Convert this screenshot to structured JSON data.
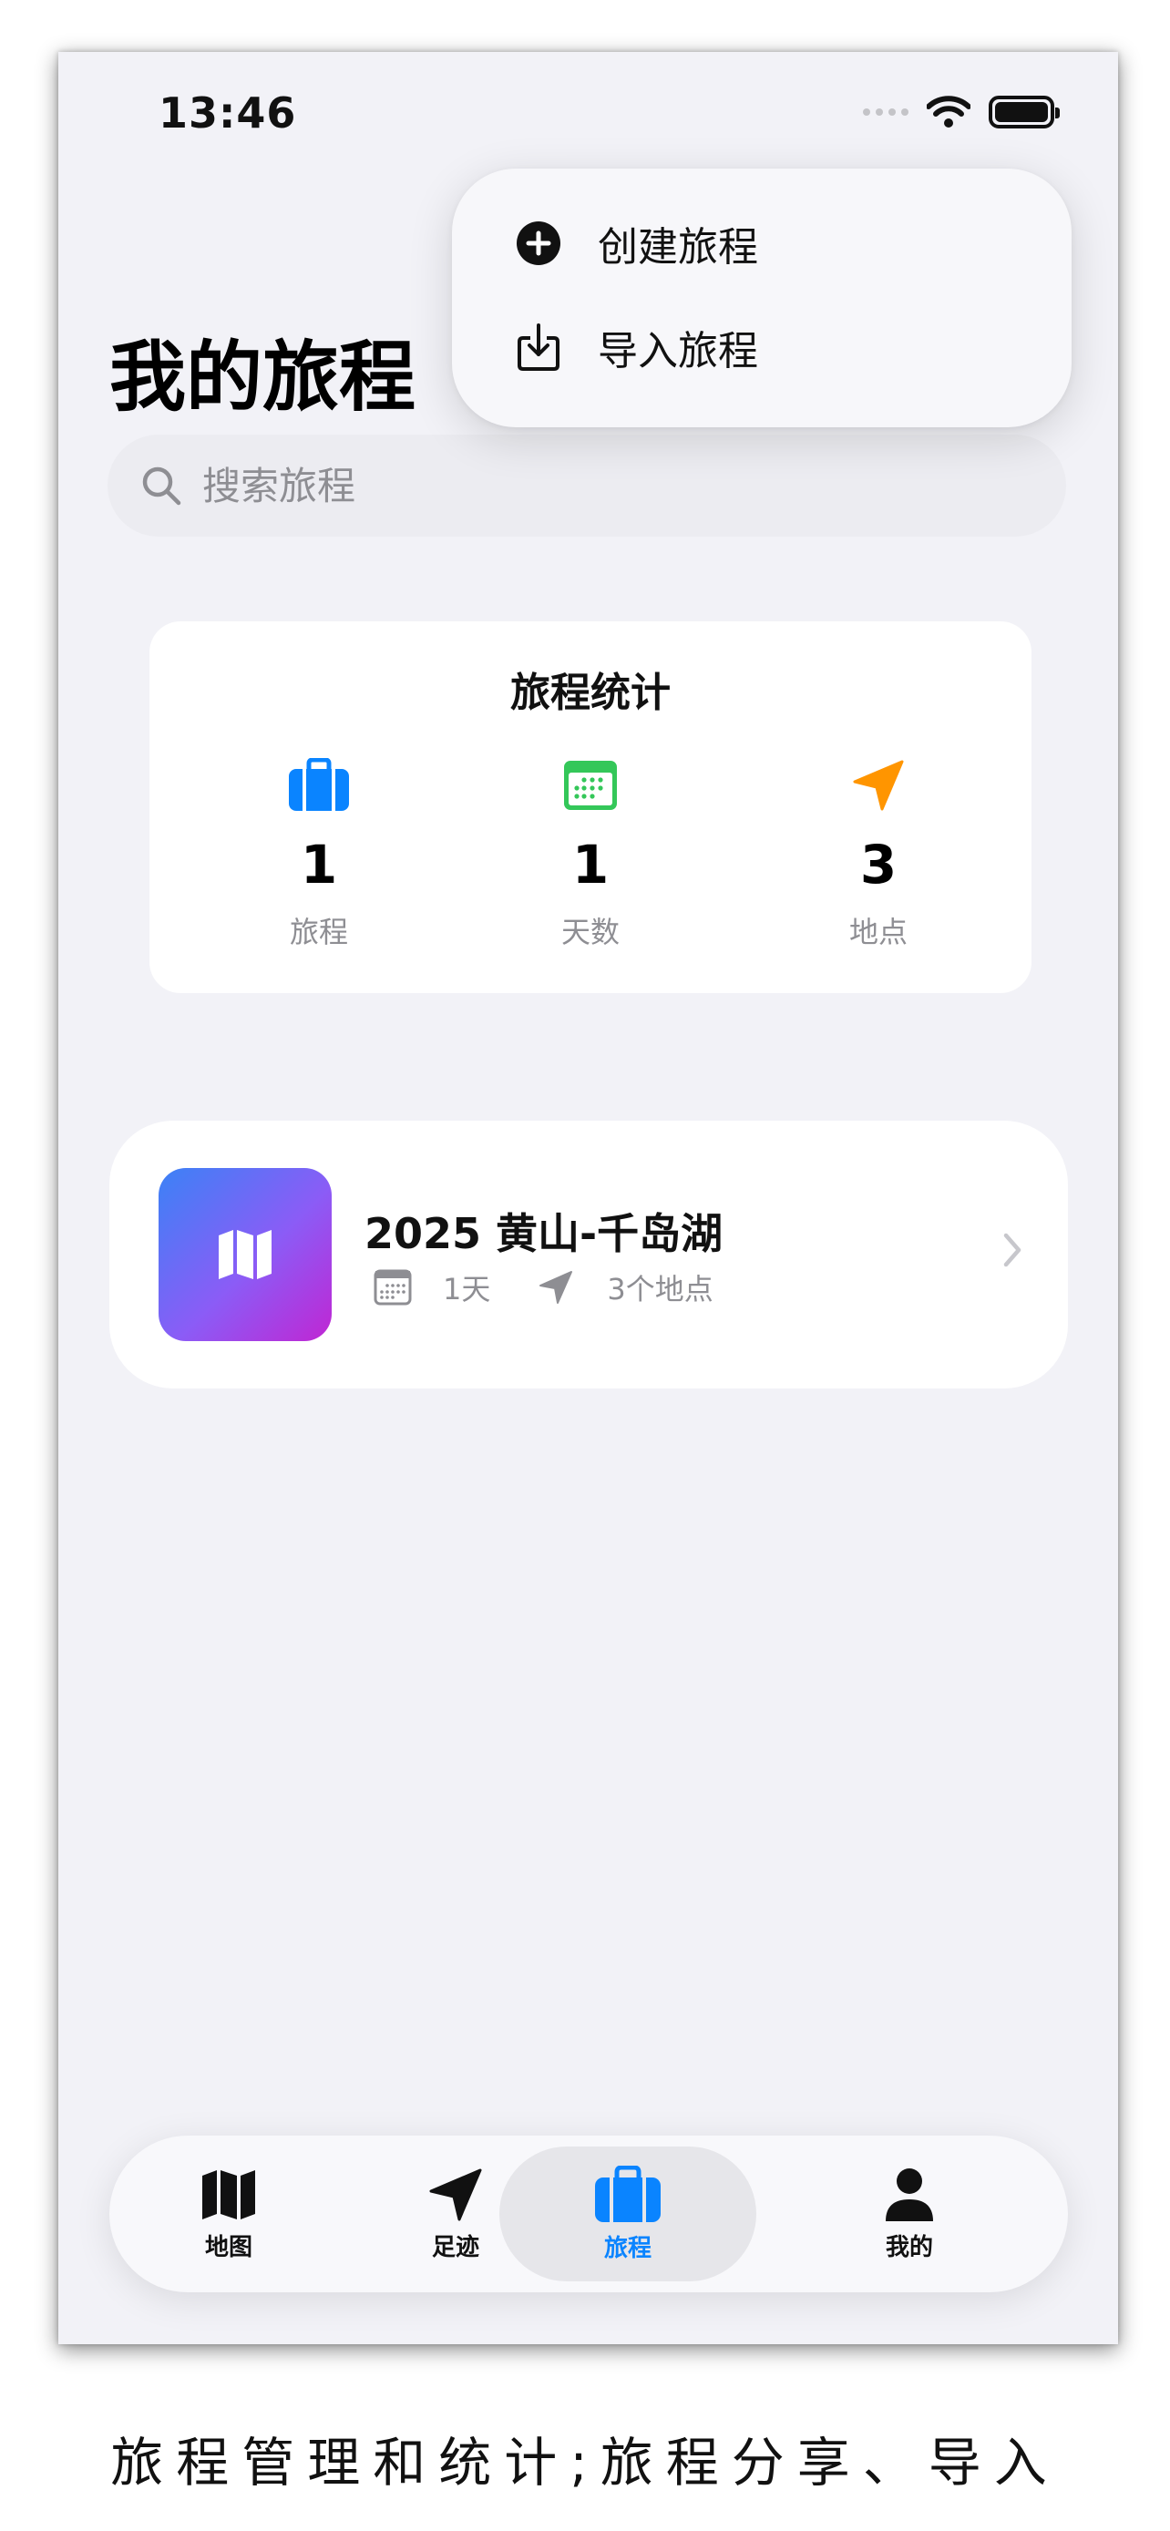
{
  "status_bar": {
    "time": "13:46",
    "icons": [
      "signal-dots",
      "wifi-icon",
      "battery-icon"
    ]
  },
  "page_title": "我的旅程",
  "search": {
    "placeholder": "搜索旅程",
    "value": ""
  },
  "menu": {
    "items": [
      {
        "label": "创建旅程",
        "icon": "plus-circle-icon"
      },
      {
        "label": "导入旅程",
        "icon": "import-icon"
      }
    ]
  },
  "stats": {
    "title": "旅程统计",
    "items": [
      {
        "value": "1",
        "label": "旅程",
        "icon": "suitcase-icon",
        "color": "#0a84ff"
      },
      {
        "value": "1",
        "label": "天数",
        "icon": "calendar-icon",
        "color": "#34c759"
      },
      {
        "value": "3",
        "label": "地点",
        "icon": "location-arrow-icon",
        "color": "#ff9500"
      }
    ]
  },
  "trips": [
    {
      "title": "2025 黄山-千岛湖",
      "days": "1天",
      "places": "3个地点",
      "icon": "map-icon"
    }
  ],
  "tab_bar": {
    "active": "旅程",
    "tabs": [
      {
        "label": "地图",
        "icon": "map-icon"
      },
      {
        "label": "足迹",
        "icon": "location-arrow-icon"
      },
      {
        "label": "旅程",
        "icon": "suitcase-icon"
      },
      {
        "label": "我的",
        "icon": "person-icon"
      }
    ]
  },
  "caption": "旅程管理和统计;旅程分享、导入",
  "colors": {
    "accent": "#0a84ff",
    "background": "#f2f2f7",
    "calendar": "#34c759",
    "location": "#ff9500"
  }
}
